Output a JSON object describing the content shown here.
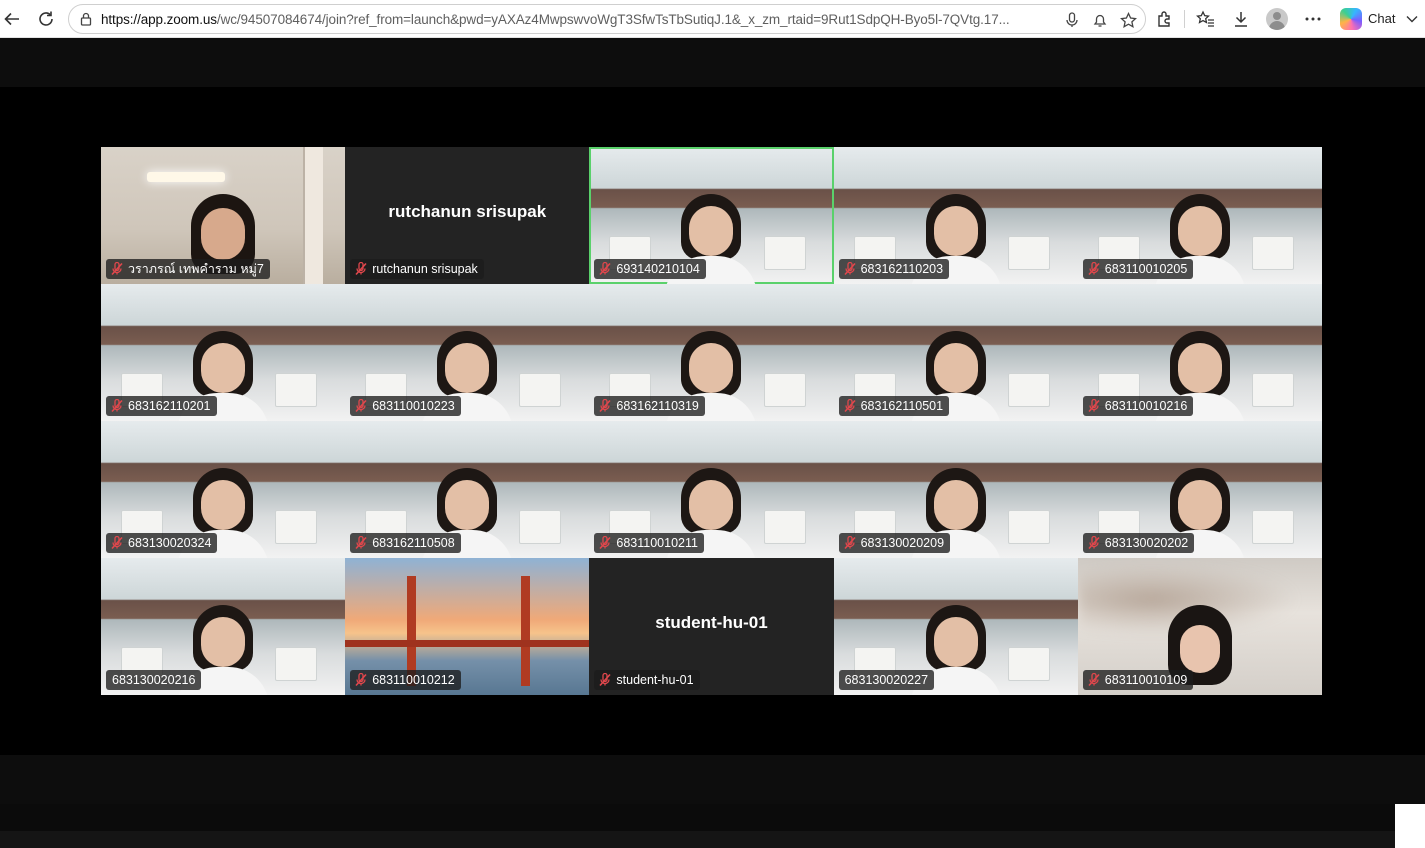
{
  "browser": {
    "url_host": "https://app.zoom.us",
    "url_rest": "/wc/94507084674/join?ref_from=launch&pwd=yAXAz4MwpswvoWgT3SfwTsTbSutiqJ.1&_x_zm_rtaid=9Rut1SdpQH-Byo5l-7QVtg.17...",
    "chat_label": "Chat",
    "icons": [
      "back-icon",
      "refresh-icon",
      "lock-icon",
      "microphone-icon",
      "bell-icon",
      "star-icon",
      "extensions-icon",
      "favorites-icon",
      "download-icon",
      "profile-icon",
      "more-icon",
      "copilot-icon",
      "chevron-down-icon"
    ]
  },
  "meeting": {
    "participants": [
      {
        "name": "วราภรณ์ เทพคำราม หมู่7",
        "muted": true,
        "video": true
      },
      {
        "name": "rutchanun srisupak",
        "muted": true,
        "video": false
      },
      {
        "name": "693140210104",
        "muted": true,
        "video": true,
        "active_speaker": true
      },
      {
        "name": "683162110203",
        "muted": true,
        "video": true
      },
      {
        "name": "683110010205",
        "muted": true,
        "video": true
      },
      {
        "name": "683162110201",
        "muted": true,
        "video": true
      },
      {
        "name": "683110010223",
        "muted": true,
        "video": true
      },
      {
        "name": "683162110319",
        "muted": true,
        "video": true
      },
      {
        "name": "683162110501",
        "muted": true,
        "video": true
      },
      {
        "name": "683110010216",
        "muted": true,
        "video": true
      },
      {
        "name": "683130020324",
        "muted": true,
        "video": true
      },
      {
        "name": "683162110508",
        "muted": true,
        "video": true
      },
      {
        "name": "683110010211",
        "muted": true,
        "video": true
      },
      {
        "name": "683130020209",
        "muted": true,
        "video": true
      },
      {
        "name": "683130020202",
        "muted": true,
        "video": true
      },
      {
        "name": "683130020216",
        "muted": false,
        "video": true
      },
      {
        "name": "683110010212",
        "muted": true,
        "video": true
      },
      {
        "name": "student-hu-01",
        "muted": true,
        "video": false
      },
      {
        "name": "683130020227",
        "muted": false,
        "video": true
      },
      {
        "name": "683110010109",
        "muted": true,
        "video": true
      }
    ]
  },
  "colors": {
    "active_speaker": "#5ad16b",
    "muted_icon": "#e0474c",
    "stage_bg": "#000000"
  }
}
